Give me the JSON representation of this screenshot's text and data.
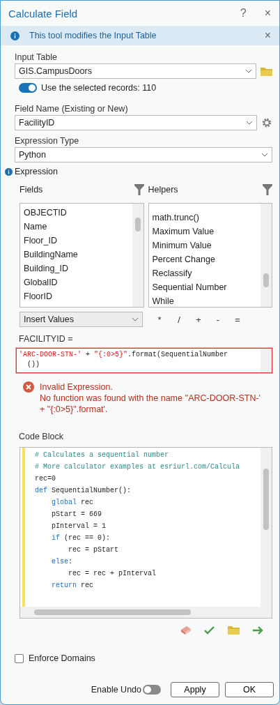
{
  "window": {
    "title": "Calculate Field",
    "help": "?",
    "close": "×"
  },
  "info_bar": {
    "text": "This tool modifies the Input Table",
    "close": "×"
  },
  "input_table": {
    "label": "Input Table",
    "value": "GIS.CampusDoors"
  },
  "use_selected": {
    "label": "Use the selected records: 110",
    "on": true
  },
  "field_name": {
    "label": "Field Name (Existing or New)",
    "value": "FacilityID"
  },
  "expression_type": {
    "label": "Expression Type",
    "value": "Python"
  },
  "expression_section": {
    "label": "Expression"
  },
  "fields": {
    "label": "Fields",
    "items": [
      "OBJECTID",
      "Name",
      "Floor_ID",
      "BuildingName",
      "Building_ID",
      "GlobalID",
      "FloorID"
    ]
  },
  "helpers": {
    "label": "Helpers",
    "items": [
      "math.trunc()",
      "Maximum Value",
      "Minimum Value",
      "Percent Change",
      "Reclassify",
      "Sequential Number",
      "While"
    ]
  },
  "insert_values": {
    "value": "Insert Values"
  },
  "operators": [
    "*",
    "/",
    "+",
    "-",
    "="
  ],
  "expression": {
    "label": "FACILITYID =",
    "invalid": true,
    "lines": [
      [
        {
          "kind": "string",
          "text": "'ARC-DOOR-STN-'"
        },
        {
          "kind": "plain",
          "text": " + "
        },
        {
          "kind": "string",
          "text": "\"{:0>5}\""
        },
        {
          "kind": "plain",
          "text": ".format(SequentialNumber"
        }
      ],
      [
        {
          "kind": "plain",
          "text": "())"
        }
      ]
    ]
  },
  "error": {
    "title": "Invalid Expression.",
    "message": "No function was found with the name ''ARC-DOOR-STN-' + \"{:0>5}\".format'."
  },
  "code_block": {
    "label": "Code Block",
    "lines": [
      {
        "segments": [
          {
            "kind": "comment",
            "text": "# Calculates a sequential number"
          }
        ]
      },
      {
        "segments": [
          {
            "kind": "comment",
            "text": "# More calculator examples at esriurl.com/Calcula"
          }
        ]
      },
      {
        "segments": [
          {
            "kind": "plain",
            "text": "rec=0"
          }
        ]
      },
      {
        "segments": [
          {
            "kind": "keyword",
            "text": "def"
          },
          {
            "kind": "plain",
            "text": " SequentialNumber():"
          }
        ],
        "children": [
          {
            "segments": [
              {
                "kind": "keyword",
                "text": "global"
              },
              {
                "kind": "plain",
                "text": " rec"
              }
            ]
          },
          {
            "segments": [
              {
                "kind": "plain",
                "text": "pStart = 669"
              }
            ]
          },
          {
            "segments": [
              {
                "kind": "plain",
                "text": "pInterval = 1"
              }
            ]
          },
          {
            "segments": [
              {
                "kind": "keyword",
                "text": "if"
              },
              {
                "kind": "plain",
                "text": " (rec == 0):"
              }
            ],
            "children": [
              {
                "segments": [
                  {
                    "kind": "plain",
                    "text": "rec = pStart"
                  }
                ]
              }
            ]
          },
          {
            "segments": [
              {
                "kind": "keyword",
                "text": "else"
              },
              {
                "kind": "plain",
                "text": ":"
              }
            ],
            "children": [
              {
                "segments": [
                  {
                    "kind": "plain",
                    "text": "rec = rec + pInterval"
                  }
                ]
              }
            ]
          },
          {
            "segments": [
              {
                "kind": "keyword",
                "text": "return"
              },
              {
                "kind": "plain",
                "text": " rec"
              }
            ]
          }
        ]
      }
    ]
  },
  "enforce_domains": {
    "label": "Enforce Domains",
    "checked": false
  },
  "enable_undo": {
    "label": "Enable Undo",
    "on": false
  },
  "buttons": [
    "Apply",
    "OK"
  ]
}
